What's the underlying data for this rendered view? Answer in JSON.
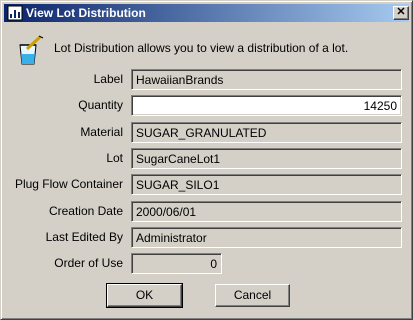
{
  "window": {
    "title": "View Lot Distribution",
    "close_glyph": "✕",
    "title_icon": "lot-distribution-icon",
    "header_icon": "beaker-icon"
  },
  "intro": "Lot Distribution allows you to view a distribution of a lot.",
  "fields": {
    "label": {
      "label": "Label",
      "value": "HawaiianBrands"
    },
    "quantity": {
      "label": "Quantity",
      "value": "14250"
    },
    "material": {
      "label": "Material",
      "value": "SUGAR_GRANULATED"
    },
    "lot": {
      "label": "Lot",
      "value": "SugarCaneLot1"
    },
    "container": {
      "label": "Plug Flow Container",
      "value": "SUGAR_SILO1"
    },
    "creation_date": {
      "label": "Creation Date",
      "value": "2000/06/01"
    },
    "last_edited_by": {
      "label": "Last Edited By",
      "value": "Administrator"
    },
    "order_of_use": {
      "label": "Order of Use",
      "value": "0"
    }
  },
  "buttons": {
    "ok": "OK",
    "cancel": "Cancel"
  },
  "colors": {
    "title_start": "#0a246a",
    "title_end": "#a6caf0",
    "face": "#d4d0c8"
  }
}
